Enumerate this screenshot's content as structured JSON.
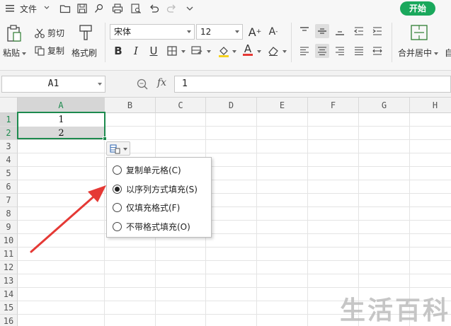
{
  "menu": {
    "file_label": "文件",
    "start_label": "开始"
  },
  "toolbar": {
    "paste": "粘贴",
    "cut": "剪切",
    "copy": "复制",
    "format_painter": "格式刷",
    "font_name": "宋体",
    "font_size": "12",
    "merge_center": "合并居中",
    "bold": "B",
    "italic": "I",
    "underline": "U",
    "font_color_glyph": "A",
    "grow_font": "A",
    "shrink_font": "A",
    "extra_truncated": "自"
  },
  "formula_bar": {
    "name_box": "A1",
    "fx_label": "fx",
    "value": "1"
  },
  "columns": [
    "A",
    "B",
    "C",
    "D",
    "E",
    "F",
    "G",
    "H"
  ],
  "rows": [
    "1",
    "2",
    "3",
    "4",
    "5",
    "6",
    "7",
    "8",
    "9",
    "10",
    "11",
    "12",
    "13",
    "14",
    "15",
    "16"
  ],
  "cells": {
    "A1": "1",
    "A2": "2"
  },
  "autofill_menu": {
    "options": [
      {
        "label": "复制单元格(C)",
        "checked": false
      },
      {
        "label": "以序列方式填充(S)",
        "checked": true
      },
      {
        "label": "仅填充格式(F)",
        "checked": false
      },
      {
        "label": "不带格式填充(O)",
        "checked": false
      }
    ]
  },
  "watermark": "生活百科",
  "colors": {
    "accent": "#1d8a4e",
    "start_button": "#1aa85c",
    "arrow": "#e53935"
  }
}
